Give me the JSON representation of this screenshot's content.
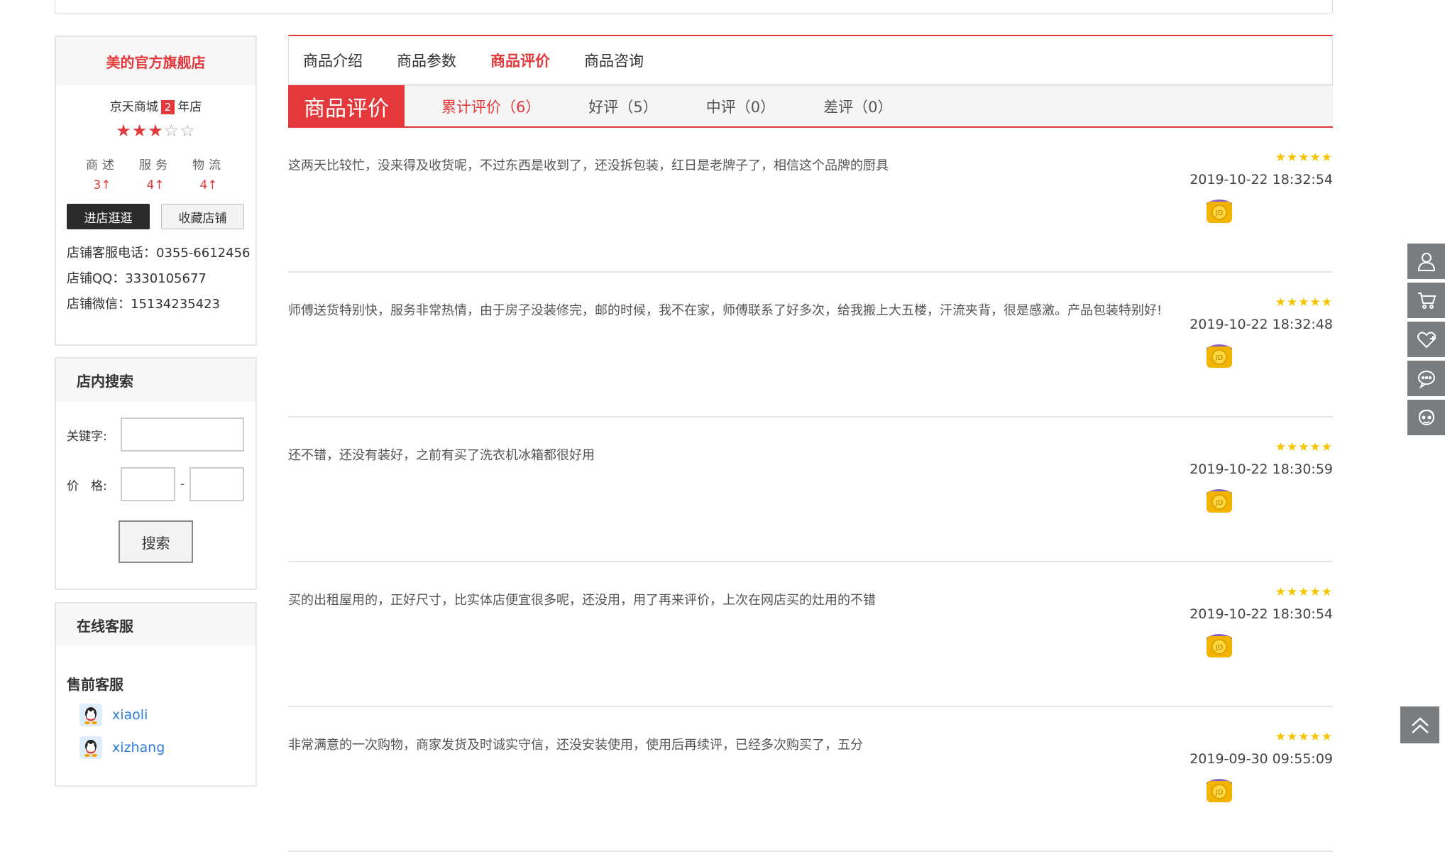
{
  "store": {
    "name": "美的官方旗舰店",
    "mall": "京天商城",
    "years": "2",
    "years_unit": "年店",
    "rating": 3,
    "rating_max": 5,
    "scores": [
      {
        "label": "商述",
        "value": "3↑"
      },
      {
        "label": "服务",
        "value": "4↑"
      },
      {
        "label": "物流",
        "value": "4↑"
      }
    ],
    "enter_label": "进店逛逛",
    "fav_label": "收藏店铺",
    "phone": "店铺客服电话：0355-6612456",
    "qq": "店铺QQ：3330105677",
    "wechat": "店铺微信：15134235423"
  },
  "search": {
    "title": "店内搜索",
    "keyword_label": "关键字:",
    "price_label": "价　格:",
    "dash": "-",
    "button": "搜索"
  },
  "service": {
    "title": "在线客服",
    "group": "售前客服",
    "agents": [
      "xiaoli",
      "xizhang"
    ]
  },
  "tabs": [
    "商品介绍",
    "商品参数",
    "商品评价",
    "商品咨询"
  ],
  "active_tab": "商品评价",
  "review_header": {
    "title": "商品评价",
    "filters": [
      "累计评价（6）",
      "好评（5）",
      "中评（0）",
      "差评（0）"
    ]
  },
  "reviews": [
    {
      "text": "这两天比较忙，没来得及收货呢，不过东西是收到了，还没拆包装，红日是老牌子了，相信这个品牌的厨具",
      "stars": "★★★★★",
      "time": "2019-10-22 18:32:54"
    },
    {
      "text": "师傅送货特别快，服务非常热情，由于房子没装修完，邮的时候，我不在家，师傅联系了好多次，给我搬上大五楼，汗流夹背，很是感激。产品包装特别好!",
      "stars": "★★★★★",
      "time": "2019-10-22 18:32:48"
    },
    {
      "text": "还不错，还没有装好，之前有买了洗衣机冰箱都很好用",
      "stars": "★★★★★",
      "time": "2019-10-22 18:30:59"
    },
    {
      "text": "买的出租屋用的，正好尺寸，比实体店便宜很多呢，还没用，用了再来评价，上次在网店买的灶用的不错",
      "stars": "★★★★★",
      "time": "2019-10-22 18:30:54"
    },
    {
      "text": "非常满意的一次购物，商家发货及时诚实守信，还没安装使用，使用后再续评，已经多次购买了，五分",
      "stars": "★★★★★",
      "time": "2019-09-30 09:55:09"
    }
  ],
  "badge_text": "JD",
  "colors": {
    "accent": "#e4393c",
    "star": "#f5c300",
    "toolbar": "#7a7d80",
    "link": "#2d7bd8"
  }
}
